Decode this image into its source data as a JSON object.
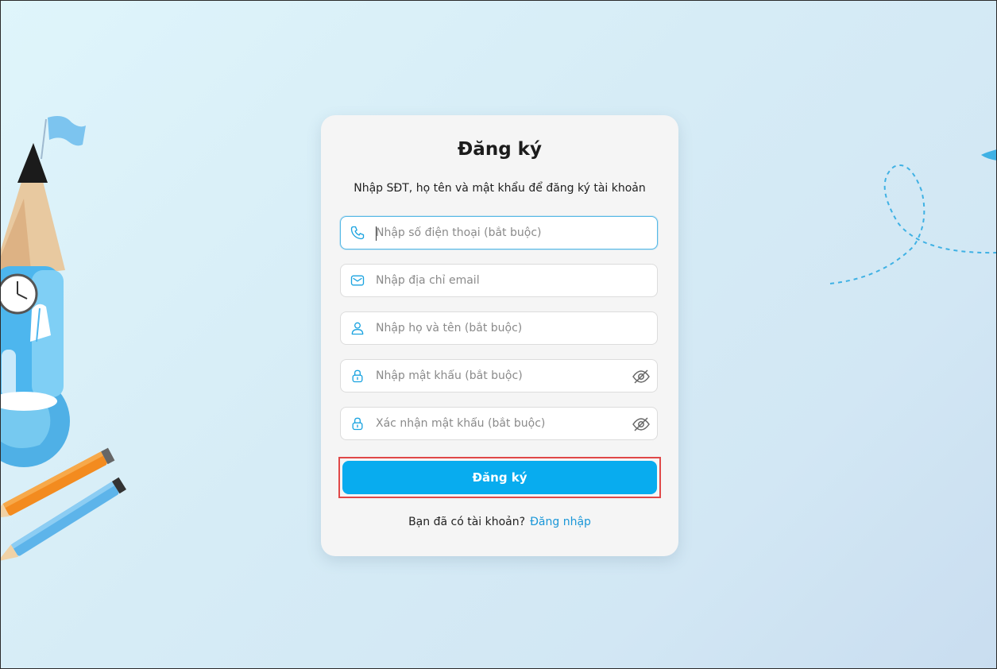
{
  "form": {
    "title": "Đăng ký",
    "subtitle": "Nhập SĐT, họ tên và mật khẩu để đăng ký tài khoản",
    "fields": [
      {
        "placeholder": "Nhập số điện thoại (bắt buộc)",
        "value": "",
        "icon": "phone-icon"
      },
      {
        "placeholder": "Nhập địa chỉ email",
        "value": "",
        "icon": "mail-icon"
      },
      {
        "placeholder": "Nhập họ và tên (bắt buộc)",
        "value": "",
        "icon": "user-icon"
      },
      {
        "placeholder": "Nhập mật khẩu (bắt buộc)",
        "value": "",
        "icon": "lock-icon"
      },
      {
        "placeholder": "Xác nhận mật khẩu (bắt buộc)",
        "value": "",
        "icon": "lock-icon"
      }
    ],
    "submit_label": "Đăng ký",
    "footer_text": "Bạn đã có tài khoản?",
    "login_link": "Đăng nhập"
  },
  "colors": {
    "accent": "#08acef",
    "link": "#1a97d8",
    "highlight_border": "#e04848"
  }
}
